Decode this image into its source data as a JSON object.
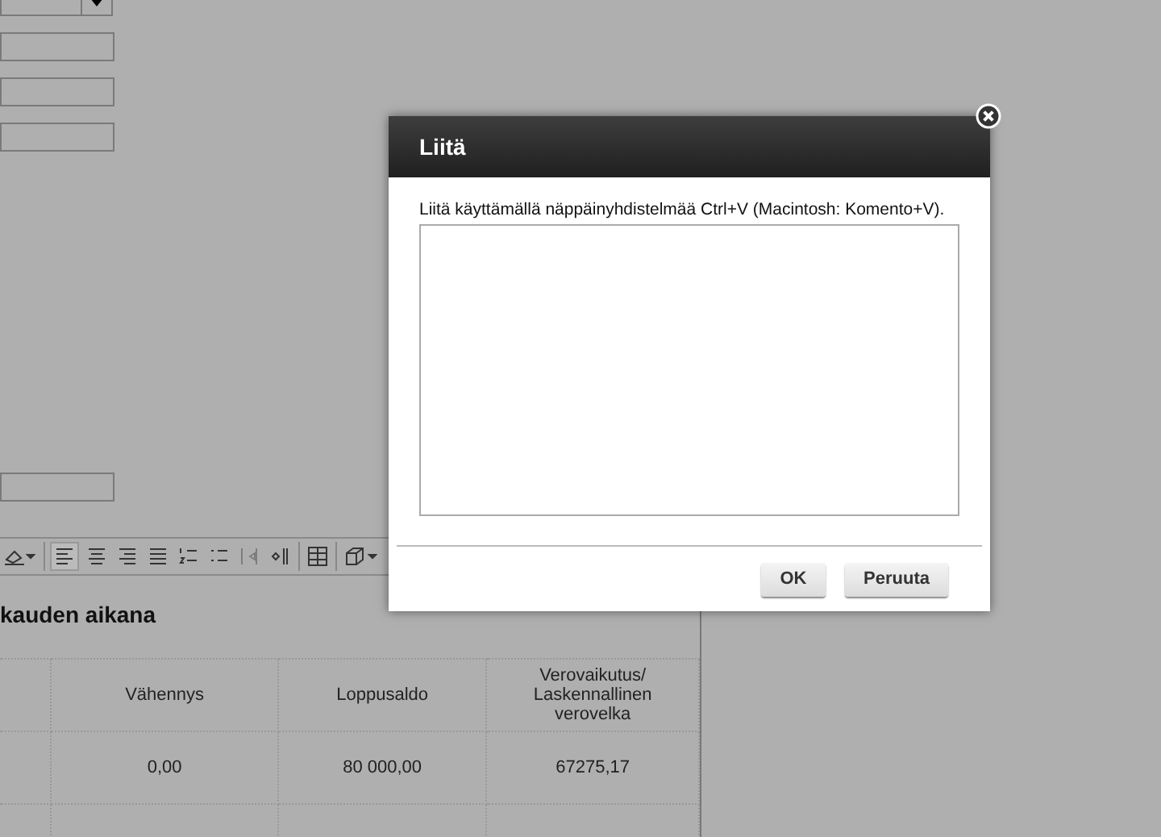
{
  "background_form": {
    "fields": [
      {
        "kind": "select"
      },
      {
        "kind": "text"
      },
      {
        "kind": "text"
      },
      {
        "kind": "text"
      }
    ],
    "lower_field": {
      "kind": "text"
    }
  },
  "toolbar": {
    "buttons": [
      {
        "kind": "fill-color",
        "selected": false,
        "disabled": false
      },
      {
        "kind": "align-left",
        "selected": true,
        "disabled": false
      },
      {
        "kind": "align-center",
        "selected": false,
        "disabled": false
      },
      {
        "kind": "align-right",
        "selected": false,
        "disabled": false
      },
      {
        "kind": "justify",
        "selected": false,
        "disabled": false
      },
      {
        "kind": "numbered-list",
        "selected": false,
        "disabled": false
      },
      {
        "kind": "bullet-list",
        "selected": false,
        "disabled": false
      },
      {
        "kind": "outdent",
        "selected": false,
        "disabled": true
      },
      {
        "kind": "indent",
        "selected": false,
        "disabled": false
      },
      {
        "kind": "table",
        "selected": false,
        "disabled": false
      },
      {
        "kind": "box",
        "selected": false,
        "disabled": false
      }
    ]
  },
  "heading": "kauden aikana",
  "table": {
    "columns": [
      "",
      "Vähennys",
      "Loppusaldo",
      "Verovaikutus/ Laskennallinen verovelka"
    ],
    "rows": [
      [
        "",
        "0,00",
        "80 000,00",
        "67275,17"
      ],
      [
        "",
        "",
        "",
        ""
      ]
    ]
  },
  "dialog": {
    "title": "Liitä",
    "instruction": "Liitä käyttämällä näppäinyhdistelmää Ctrl+V (Macintosh: Komento+V).",
    "buttons": [
      "OK",
      "Peruuta"
    ]
  }
}
